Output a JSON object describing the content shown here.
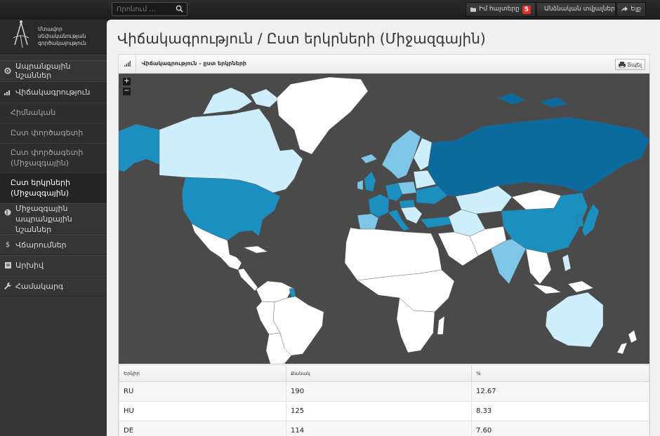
{
  "app": {
    "logo_lines": [
      "Մտավոր",
      "սեփականության",
      "գործակալություն"
    ]
  },
  "topbar": {
    "search_placeholder": "Որոնում ...",
    "requests_label": "Իմ հայտերը",
    "requests_count": "5",
    "account_label": "Անձնական տվյալներ",
    "logout_label": "Ելք"
  },
  "sidebar": {
    "items": [
      {
        "label": "Ապրանքային նշաններ",
        "icon": "gear-icon"
      },
      {
        "label": "Վիճակագրություն",
        "icon": "bar-chart-icon"
      },
      {
        "label": "Հիմնական",
        "sub": true
      },
      {
        "label": "Ըստ փործագետի",
        "sub": true
      },
      {
        "label": "Ըստ փործագետի (Միջազգային)",
        "sub": true
      },
      {
        "label": "Ըստ երկրների (Միջազգային)",
        "sub": true,
        "active": true
      },
      {
        "label": "Միջազգային ապրանքային նշաններ",
        "icon": "globe-icon"
      },
      {
        "label": "Վճարումներ",
        "icon": "dollar-icon"
      },
      {
        "label": "Արխիվ",
        "icon": "archive-icon"
      },
      {
        "label": "Համակարգ",
        "icon": "wrench-icon"
      }
    ]
  },
  "page": {
    "title": "Վիճակագրություն / Ըստ երկրների (Միջազգային)",
    "panel_title": "Վիճակագրություն - ըստ երկրների",
    "print_label": "Տպել"
  },
  "map": {
    "zoom_in": "+",
    "zoom_out": "−",
    "colors": {
      "ocean": "#4a4a4a",
      "none": "#ffffff",
      "low": "#cfeefb",
      "mid": "#7dc6e8",
      "high": "#1a8fc0",
      "top": "#0b6a9e"
    }
  },
  "table": {
    "headers": [
      "Երկիր",
      "Քանակ",
      "%"
    ],
    "rows": [
      [
        "RU",
        "190",
        "12.67"
      ],
      [
        "HU",
        "125",
        "8.33"
      ],
      [
        "DE",
        "114",
        "7.60"
      ]
    ]
  }
}
